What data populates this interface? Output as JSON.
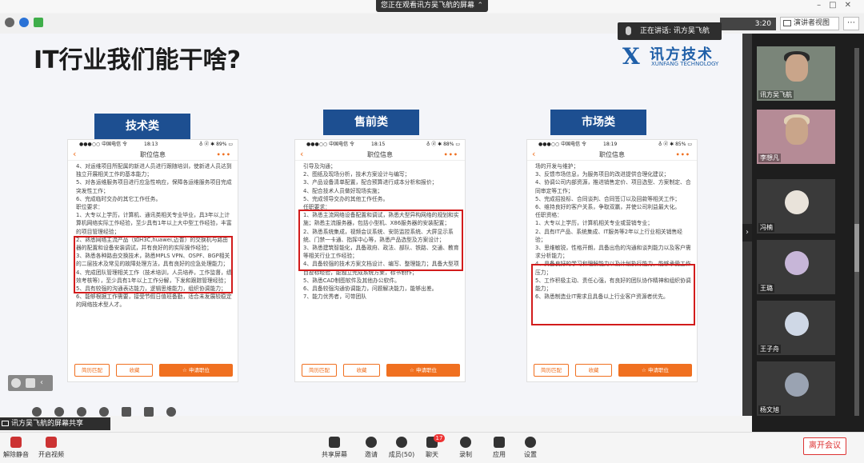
{
  "top_banner": {
    "text": "您正在观看讯方吴飞航的屏幕",
    "close": "⌃"
  },
  "toolbar": {
    "time": "3:20",
    "presenter_view": "演讲者视图",
    "more": "⋯"
  },
  "speaking": {
    "text": "正在讲话: 讯方吴飞航"
  },
  "slide": {
    "title": "IT行业我们能干啥?",
    "logo": {
      "mark": "X",
      "name": "讯方技术",
      "english": "XUNFANG TECHNOLOGY"
    },
    "columns": [
      {
        "category": "技术类",
        "status": {
          "left": "●●●○○ 中国电信 令",
          "time": "18:13",
          "right": "♁ ⓓ ✱ 89% ▭"
        },
        "header": "职位信息",
        "lines": [
          "4、对运维项目所配属的新进人员进行跟随培训，使新进人员达到独立开展相关工作的基本能力；",
          "5、对各运维服务项目进行应急性响应，保障各运维服务项目完成突发性工作；",
          "6、完成临时交办的其它工作任务。",
          "职位要求：",
          "1、大专以上学历，计算机、通讯类相关专业毕业，具3年以上计算机网络实际工作经验，至少具有1年以上大中型工作经验，丰富的项目管理经验；",
          "2、熟悉网络主流产品（如H3C,huawei,迈普）的交换机与路由器的配置和设备安装调试，并有良好的的实际操作经验；",
          "3、熟悉各种路由交换技术，熟悉MPLS VPN、OSPF、BGP相关的二层技术及常见的故障处理方法，具有良好的应急处理能力；",
          "4、完成团队管理相关工作（技术培训，人员培养，工作监督，绩效考核等），至少具有1年以上工作分解，下发和跟踪管理经验；",
          "5、具有较强的沟通表达能力，逻辑思维能力，组织协调能力；",
          "6、能够根据工作需要，接受节假日值班备勤，适合未发展较稳定的网络技术型人才。"
        ],
        "buttons": [
          "简历匹配",
          "收藏",
          "☆ 申请职位"
        ]
      },
      {
        "category": "售前类",
        "status": {
          "left": "●●●○○ 中国电信 令",
          "time": "18:15",
          "right": "♁ ⓓ ✱ 88% ▭"
        },
        "header": "职位信息",
        "lines": [
          "引导及沟通；",
          "2、图纸及现场分析，技术方案设计与编写；",
          "3、产品设备清单配置，配合预算进行成本分析和报价；",
          "4、配合技术人员做好现场实施；",
          "5、完成领导交办的其他工作任务。",
          "任职要求：",
          "1、熟悉主流网络设备配置和调试，熟悉大型异构网络的规划和实施；熟悉主流服务器，包括小型机、X86服务器的安装配置；",
          "2、熟悉系统集成，视频会议系统、安防监控系统、大屏显示系统、门禁一卡通、指挥中心等，熟悉产品选型及方案设计；",
          "3、熟悉建筑智能化，具备政府、政法、部队、铁路、交通、教育等相关行业工作经验；",
          "4、具备较强的技术方案文档设计、编写、整理能力；具备大型项目投标经验，能独立完成系统方案，标书制作；",
          "5、熟悉CAD制图软件及其他办公软件。",
          "6、具备较强沟通协调能力，问题解决能力，能够出差。",
          "7、能力优秀者，可带团队"
        ],
        "buttons": [
          "简历匹配",
          "收藏",
          "☆ 申请职位"
        ]
      },
      {
        "category": "市场类",
        "status": {
          "left": "●●●○○ 中国电信 令",
          "time": "18:19",
          "right": "♁ ⓓ ✱ 85% ▭"
        },
        "header": "职位信息",
        "lines": [
          "场的开发与维护；",
          "3、反馈市场信息，为服务项目的改进提供合理化建议；",
          "4、协调公司内部资源，推进销售定价、项目选型、方案制定、合同审定等工作；",
          "5、完成招投标、合同谈判、合同签订以及回款等相关工作；",
          "6、维持良好的客户关系，争取双赢，并使公司利益最大化。",
          "任职资格：",
          "1、大专以上学历，计算机相关专业或营销专业；",
          "2、具有IT产品、系统集成、IT服务等2年以上行业相关销售经验；",
          "3、思维敏锐，性格开朗，具备出色的沟通和谈判能力以及客户需求分析能力；",
          "4、具备良好的学习和理解能力以及计划执行能力，能够承受工作压力；",
          "5、工作积极主动、责任心强，有良好的团队协作精神和组织协调能力；",
          "6、熟悉制造业IT需求且具备以上行业客户资源者优先。"
        ],
        "buttons": [
          "简历匹配",
          "收藏",
          "☆ 申请职位"
        ]
      }
    ]
  },
  "participants": [
    {
      "name": "讯方吴飞航"
    },
    {
      "name": "李想凡"
    },
    {
      "name": "冯楠"
    },
    {
      "name": "王璐"
    },
    {
      "name": "王子舟"
    },
    {
      "name": "杨文旭"
    }
  ],
  "share_label": "讯方吴飞航的屏幕共享",
  "bottom": {
    "mute": "解除静音",
    "video": "开启视频",
    "share": "共享屏幕",
    "invite": "邀请",
    "members": "成员(50)",
    "chat": "聊天",
    "chat_badge": "17",
    "record": "录制",
    "apps": "应用",
    "settings": "设置",
    "leave": "离开会议"
  },
  "colors": {
    "category_bg": "#1d4f91",
    "highlight_box": "#d21c1c",
    "accent_orange": "#f07020",
    "leave_red": "#d33"
  }
}
